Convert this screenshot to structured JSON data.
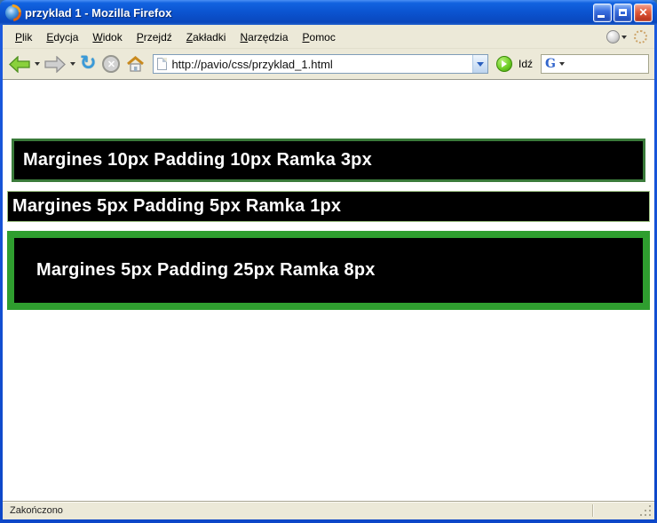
{
  "window": {
    "title": "przyklad 1 - Mozilla Firefox"
  },
  "menu": {
    "items": [
      "Plik",
      "Edycja",
      "Widok",
      "Przejdź",
      "Zakładki",
      "Narzędzia",
      "Pomoc"
    ]
  },
  "toolbar": {
    "url": "http://pavio/css/przyklad_1.html",
    "go_label": "Idź",
    "search_logo": "G"
  },
  "content": {
    "boxes": [
      "Margines 10px Padding 10px Ramka 3px",
      "Margines 5px Padding 5px Ramka 1px",
      "Margines 5px Padding 25px Ramka 8px"
    ]
  },
  "statusbar": {
    "text": "Zakończono"
  },
  "icons": {
    "back": "back-arrow",
    "forward": "forward-arrow",
    "reload": "reload-circular-arrows",
    "stop": "stop-cross",
    "home": "house",
    "go": "green-play-circle",
    "search": "google-g"
  },
  "colors": {
    "titlebar_blue": "#0b55d2",
    "chrome_beige": "#ece9d8",
    "page_bg": "#ffffff",
    "box_bg": "#000000",
    "box_text": "#ffffff",
    "box1_border": "#3a7a3a",
    "box2_border": "#9dc183",
    "box3_border": "#2f9e2f",
    "close_red": "#c23a1f"
  }
}
